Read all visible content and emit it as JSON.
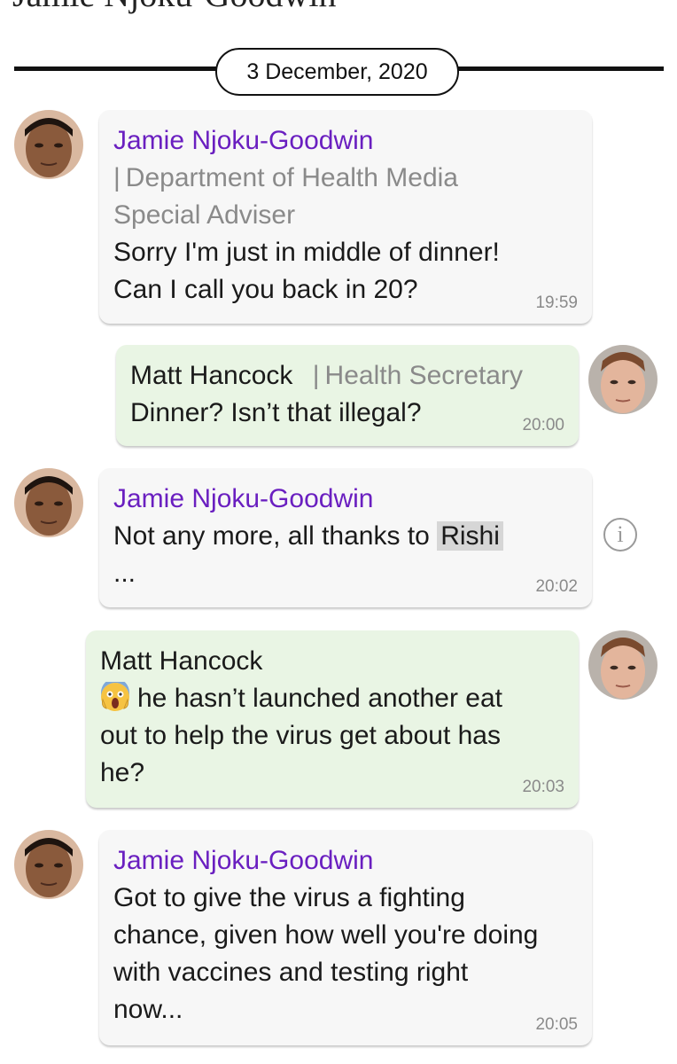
{
  "header": {
    "partial_title": "Jamie Njoku-Goodwin",
    "date": "3 December, 2020"
  },
  "messages": [
    {
      "sender": "Jamie Njoku-Goodwin",
      "role": "Department of Health Media",
      "role_cont": "Special Adviser",
      "text_lines": [
        "Sorry I'm just in middle of dinner!",
        "Can I call you back in 20?"
      ],
      "time": "19:59"
    },
    {
      "sender": "Matt Hancock",
      "role": "Health Secretary",
      "text_lines": [
        "Dinner? Isn’t that illegal?"
      ],
      "time": "20:00"
    },
    {
      "sender": "Jamie Njoku-Goodwin",
      "text_before": "Not any more, all thanks to",
      "highlight": "Rishi",
      "text_after": "...",
      "time": "20:02"
    },
    {
      "sender": "Matt Hancock",
      "emoji": "scream-emoji",
      "text_lines": [
        "he hasn’t launched another eat",
        "out to help the virus get about has",
        "he?"
      ],
      "time": "20:03"
    },
    {
      "sender": "Jamie Njoku-Goodwin",
      "text_lines": [
        "Got to give the virus a fighting",
        "chance, given how well you're doing",
        "with vaccines and testing right",
        "now..."
      ],
      "time": "20:05"
    }
  ],
  "icons": {
    "info": "info-icon",
    "info_glyph": "i"
  },
  "colors": {
    "jamie_name": "#6a1fc0",
    "incoming_bubble": "#f7f7f7",
    "outgoing_bubble": "#e9f5e4",
    "meta_gray": "#8a8a8a"
  }
}
